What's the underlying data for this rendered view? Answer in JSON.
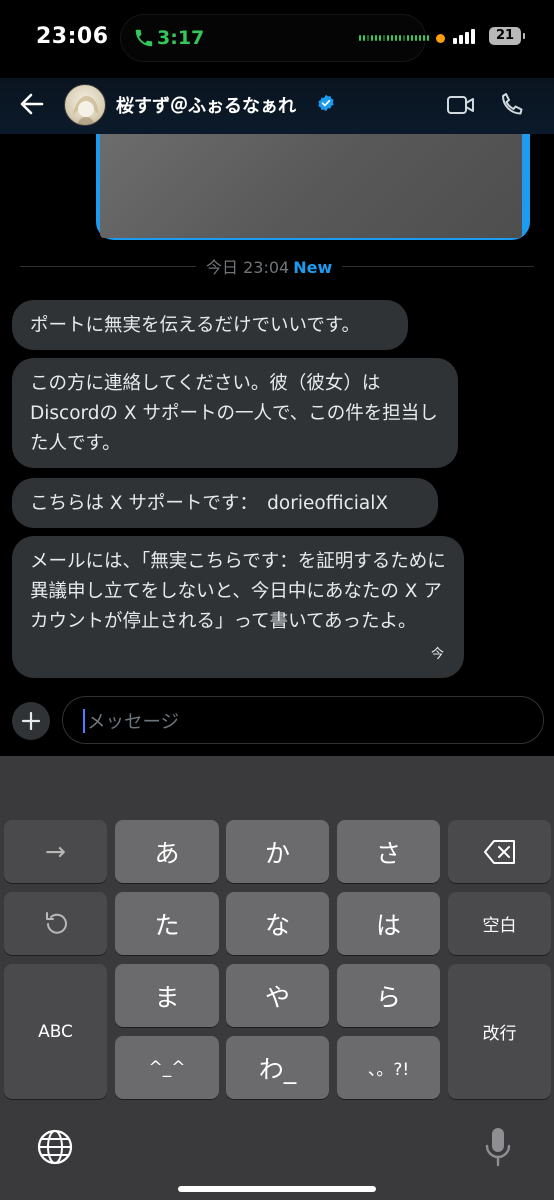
{
  "status_bar": {
    "time": "23:06",
    "call_duration": "3:17",
    "battery_level": "21",
    "icons": [
      "phone-icon",
      "signal-icon",
      "battery-icon"
    ]
  },
  "header": {
    "contact_name": "桜すず＠ふぉるなぁれ",
    "icons": [
      "back-arrow-icon",
      "avatar",
      "verified-badge-icon",
      "video-call-icon",
      "phone-call-icon"
    ],
    "verified_color": "#1d9bf0"
  },
  "chat": {
    "divider_time": "今日 23:04",
    "divider_new": "New",
    "messages": [
      {
        "text": "ポートに無実を伝えるだけでいいです。"
      },
      {
        "text": "この方に連絡してください。彼（彼女）は Discordの X サポートの一人で、この件を担当した人です。"
      },
      {
        "text": "こちらは X サポートです：　dorieofficialX"
      },
      {
        "text": "メールには、「無実こちらです：を証明するために異議申し立てをしないと、今日中にあなたの X アカウントが停止される」って書いてあったよ。",
        "status": "今"
      }
    ]
  },
  "composer": {
    "placeholder": "メッセージ",
    "add_label": "+"
  },
  "keyboard": {
    "keys": {
      "arrow": "→",
      "a": "あ",
      "ka": "か",
      "sa": "さ",
      "ta": "た",
      "na": "な",
      "ha": "は",
      "space": "空白",
      "abc": "ABC",
      "ma": "ま",
      "ya": "や",
      "ra": "ら",
      "return": "改行",
      "kaomoji": "^_^",
      "wa": "わ_",
      "punct": "、。?!"
    }
  },
  "colors": {
    "accent": "#1d9bf0",
    "call_green": "#35c759",
    "bubble": "#2f3336"
  }
}
